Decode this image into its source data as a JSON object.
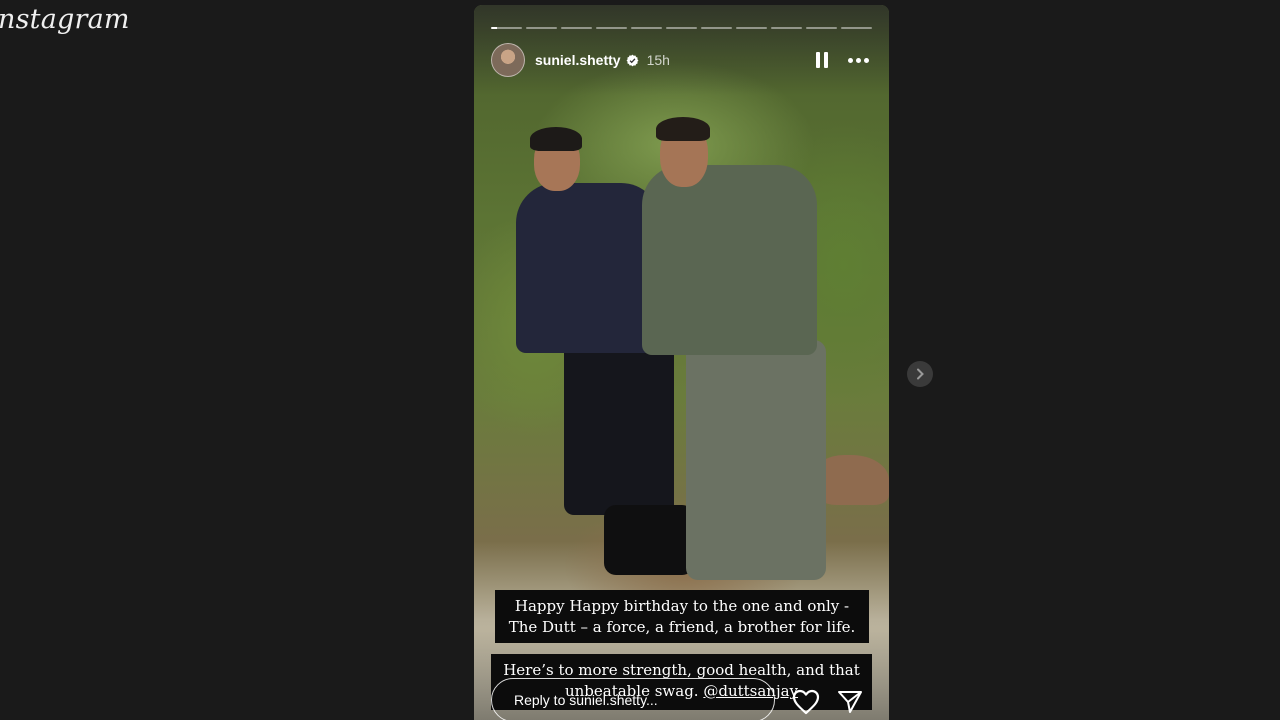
{
  "app": {
    "logo_text": "nstagram"
  },
  "story": {
    "progress_segments": 11,
    "active_segment": 1,
    "active_progress": 0.2,
    "header": {
      "username": "suniel.shetty",
      "time": "15h",
      "verified": true
    },
    "photo": {
      "description_icon": "photo-of-two-men-in-forest"
    },
    "captions": [
      {
        "lines": [
          "Happy Happy birthday to the one and only -",
          "The Dutt – a force, a friend, a brother for life."
        ]
      },
      {
        "line1": "Here’s to more strength, good health, and that",
        "line2_prefix": "unbeatable swag. ",
        "mention": "@duttsanjay"
      }
    ],
    "reply": {
      "placeholder": "Reply to suniel.shetty..."
    },
    "icons": {
      "pause": "pause-icon",
      "more": "more-options-icon",
      "like": "heart-icon",
      "share": "send-icon",
      "next": "chevron-right-icon"
    }
  },
  "colors": {
    "background": "#1a1a1a",
    "verified_badge": "#ffffff"
  }
}
